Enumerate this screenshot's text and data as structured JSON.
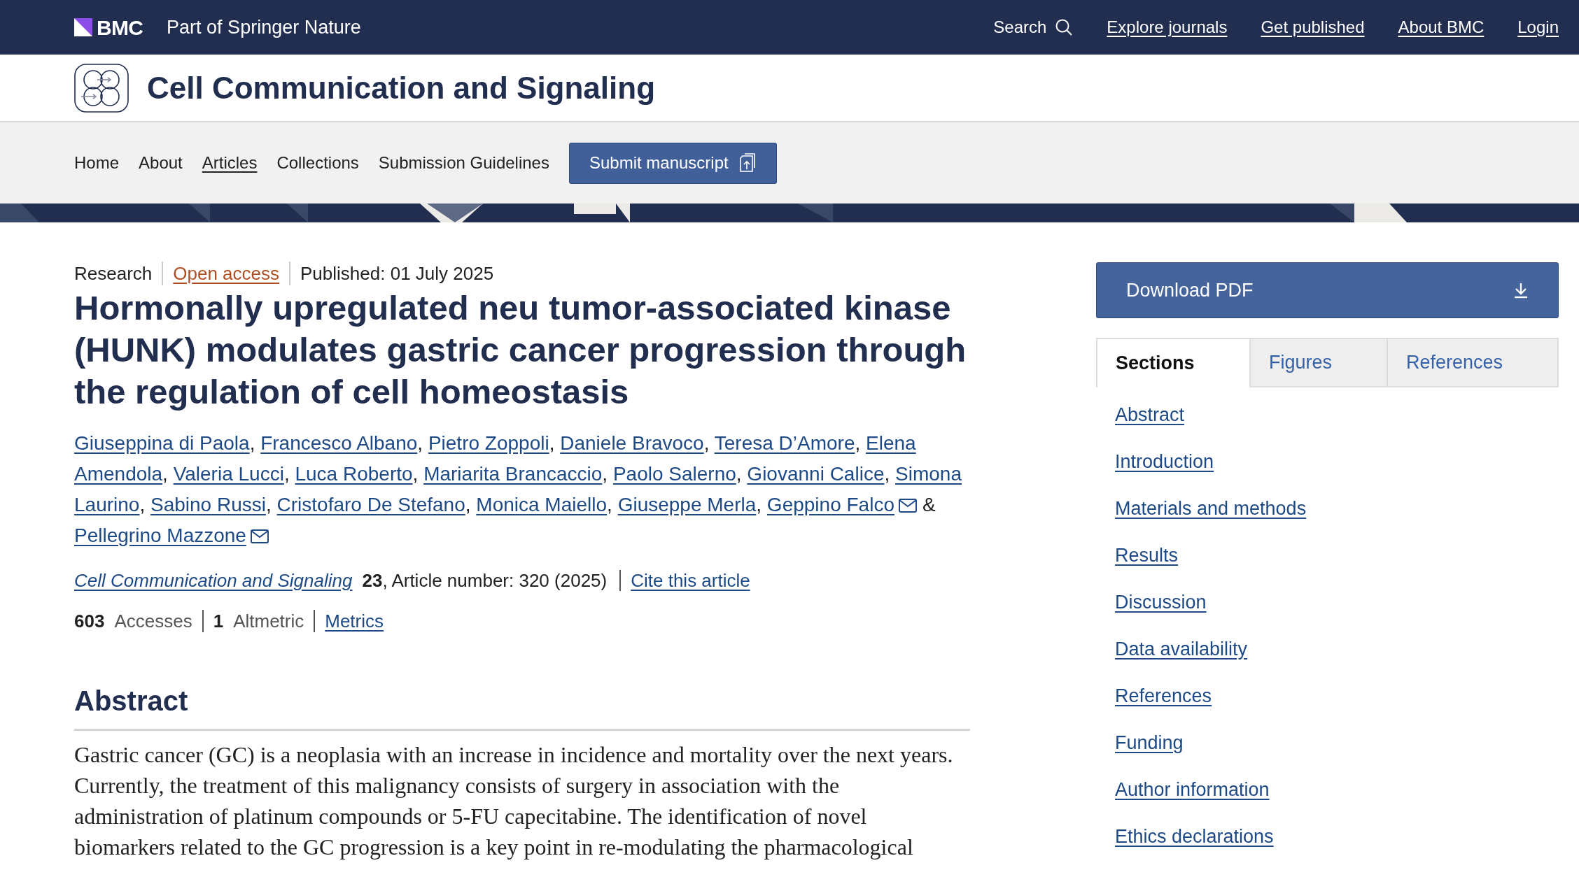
{
  "top_bar": {
    "brand": "BMC",
    "tagline": "Part of Springer Nature",
    "search": "Search",
    "links": [
      "Explore journals",
      "Get published",
      "About BMC",
      "Login"
    ]
  },
  "journal": {
    "title": "Cell Communication and Signaling"
  },
  "nav": {
    "items": [
      {
        "label": "Home",
        "selected": false
      },
      {
        "label": "About",
        "selected": false
      },
      {
        "label": "Articles",
        "selected": true
      },
      {
        "label": "Collections",
        "selected": false
      },
      {
        "label": "Submission Guidelines",
        "selected": false
      }
    ],
    "submit": "Submit manuscript"
  },
  "article": {
    "type": "Research",
    "access": "Open access",
    "published": "Published: 01 July 2025",
    "title": "Hormonally upregulated neu tumor-associated kinase (HUNK) modulates gastric cancer progression through the regulation of cell homeostasis",
    "authors": [
      {
        "name": "Giuseppina di Paola",
        "corresponding": false,
        "after": ","
      },
      {
        "name": "Francesco Albano",
        "corresponding": false,
        "after": ","
      },
      {
        "name": "Pietro Zoppoli",
        "corresponding": false,
        "after": ","
      },
      {
        "name": "Daniele Bravoco",
        "corresponding": false,
        "after": ","
      },
      {
        "name": "Teresa D’Amore",
        "corresponding": false,
        "after": ","
      },
      {
        "name": [
          "Elena",
          "Amendola"
        ],
        "corresponding": false,
        "after": ","
      },
      {
        "name": "Valeria Lucci",
        "corresponding": false,
        "after": ","
      },
      {
        "name": "Luca Roberto",
        "corresponding": false,
        "after": ","
      },
      {
        "name": "Mariarita Brancaccio",
        "corresponding": false,
        "after": ","
      },
      {
        "name": "Paolo Salerno",
        "corresponding": false,
        "after": ","
      },
      {
        "name": "Giovanni Calice",
        "corresponding": false,
        "after": ","
      },
      {
        "name": [
          "Simona",
          "Laurino"
        ],
        "corresponding": false,
        "after": ","
      },
      {
        "name": "Sabino Russi",
        "corresponding": false,
        "after": ","
      },
      {
        "name": "Cristofaro De Stefano",
        "corresponding": false,
        "after": ","
      },
      {
        "name": "Monica Maiello",
        "corresponding": false,
        "after": ","
      },
      {
        "name": "Giuseppe Merla",
        "corresponding": false,
        "after": ","
      },
      {
        "name": "Geppino Falco",
        "corresponding": true,
        "after": "&"
      },
      {
        "name": "Pellegrino Mazzone",
        "corresponding": true
      }
    ],
    "citation": {
      "journal": "Cell Communication and Signaling",
      "volume": "23",
      "details": ", Article number: 320 (2025)",
      "cite": "Cite this article"
    },
    "metrics": {
      "accesses_count": "603",
      "accesses_label": "Accesses",
      "altmetric_count": "1",
      "altmetric_label": "Altmetric",
      "link": "Metrics"
    },
    "abstract": {
      "heading": "Abstract",
      "text": "Gastric cancer (GC) is a neoplasia with an increase in incidence and mortality over the next years. Currently, the treatment of this malignancy consists of surgery in association with the administration of platinum compounds or 5-FU capecitabine. The identification of novel biomarkers related to the GC progression is a key point in re-modulating the pharmacological"
    }
  },
  "sidebar": {
    "download": "Download PDF",
    "tabs": [
      {
        "label": "Sections",
        "selected": true
      },
      {
        "label": "Figures",
        "selected": false
      },
      {
        "label": "References",
        "selected": false
      }
    ],
    "sections": [
      "Abstract",
      "Introduction",
      "Materials and methods",
      "Results",
      "Discussion",
      "Data availability",
      "References",
      "Funding",
      "Author information",
      "Ethics declarations"
    ]
  }
}
